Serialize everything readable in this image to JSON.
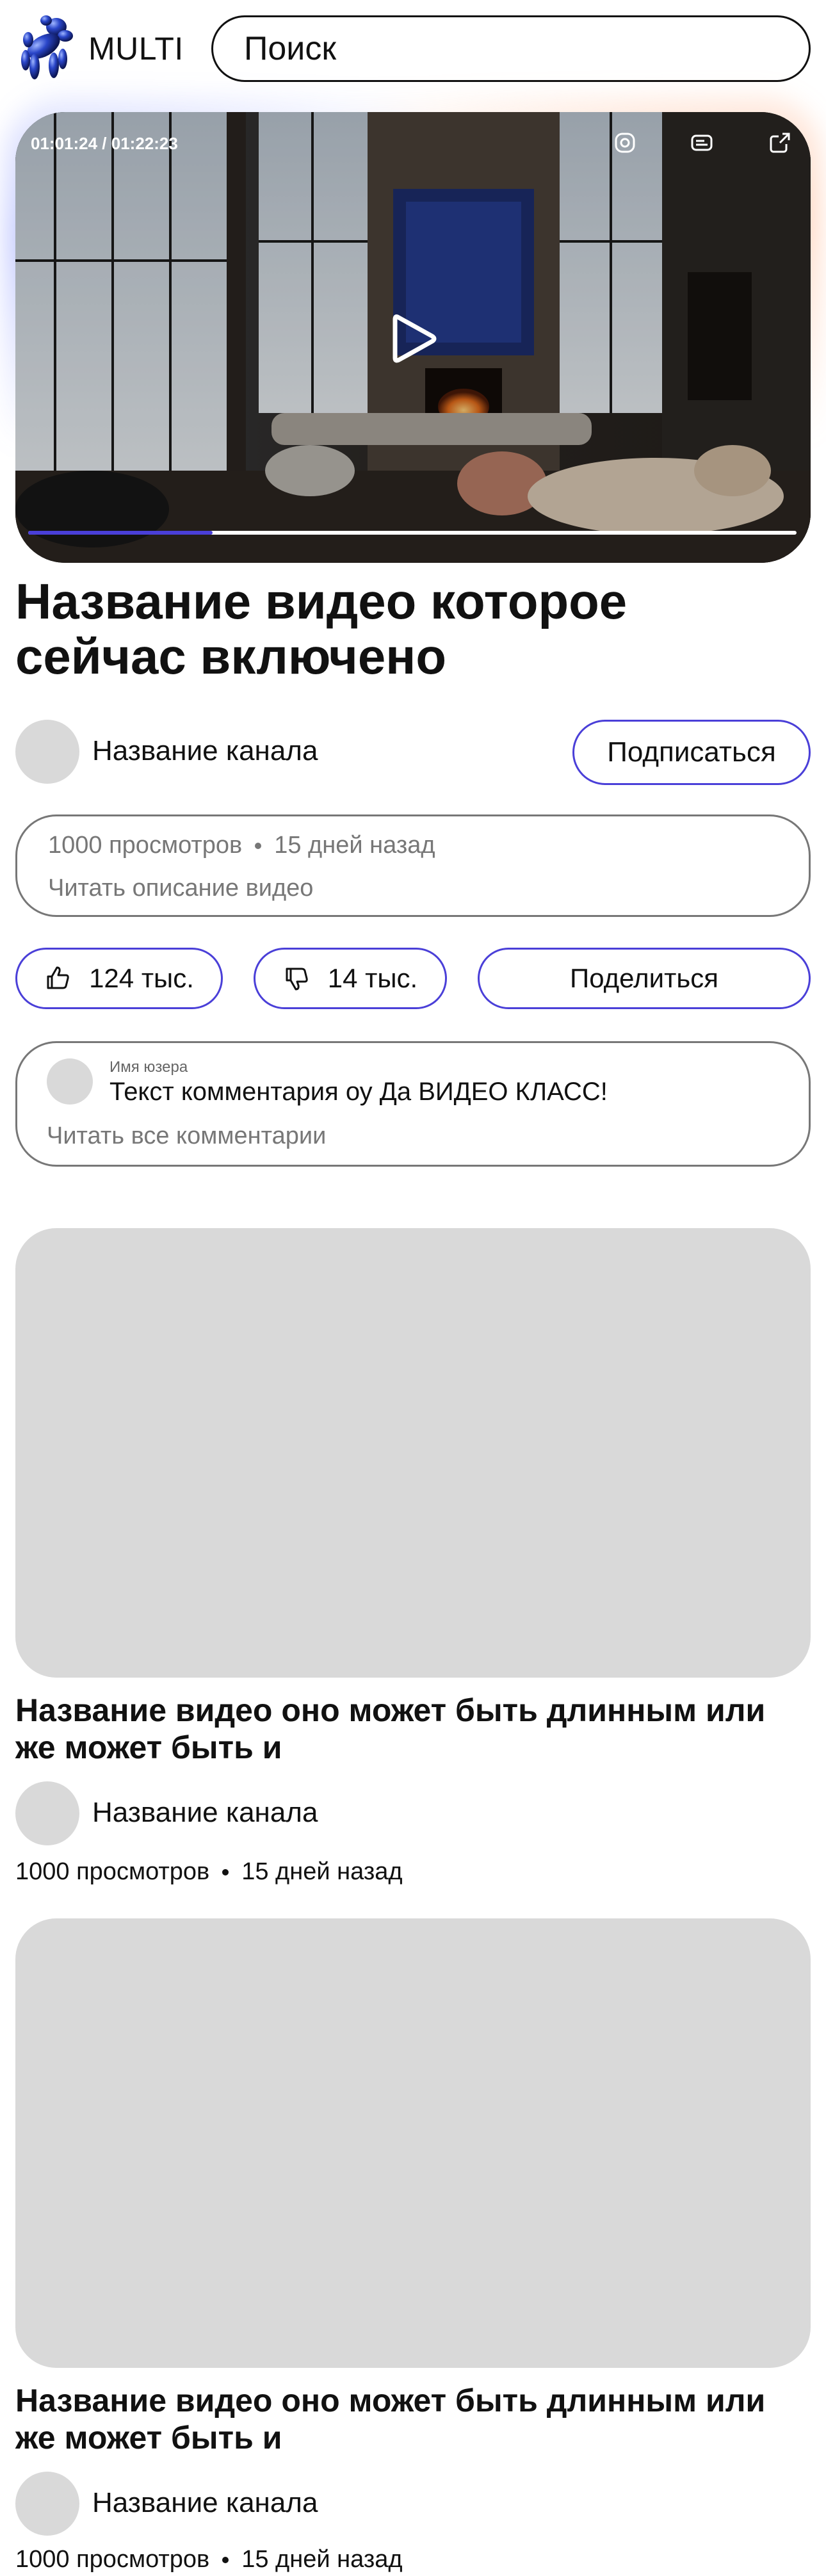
{
  "header": {
    "logo_text": "MULTI",
    "search_placeholder": "Поиск"
  },
  "player": {
    "time": "01:01:24 / 01:22:23",
    "progress": 0.24,
    "accent_color": "#4a3fd8"
  },
  "video": {
    "title": "Название видео которое сейчас включено",
    "channel_name": "Название канала",
    "subscribe_label": "Подписаться",
    "views": "1000 просмотров",
    "age": "15 дней назад",
    "description_link": "Читать описание видео",
    "likes": "124 тыс.",
    "dislikes": "14 тыс.",
    "share_label": "Поделиться"
  },
  "comments": {
    "user": "Имя юзера",
    "text": "Текст комментария оу Да ВИДЕО КЛАСС!",
    "all_link": "Читать все комментарии"
  },
  "recommended": [
    {
      "title": "Название видео оно может быть длинным или же может быть и",
      "channel": "Название канала",
      "views": "1000 просмотров",
      "age": "15 дней назад"
    },
    {
      "title": "Название видео оно может быть длинным или же может быть и",
      "channel": "Название канала",
      "views": "1000 просмотров",
      "age": "15 дней назад"
    }
  ],
  "icons": {
    "logo": "balloon-dog-icon",
    "settings": "settings-icon",
    "subtitles": "subtitles-icon",
    "share": "share-icon",
    "play": "play-icon",
    "like": "thumb-up-icon",
    "dislike": "thumb-down-icon"
  }
}
